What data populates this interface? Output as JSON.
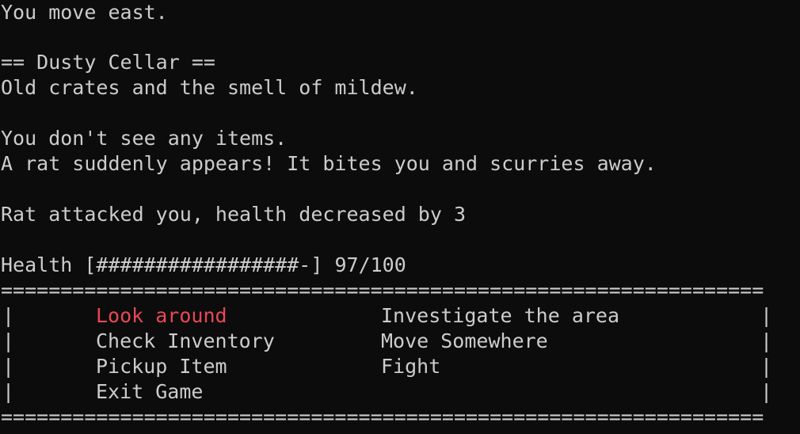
{
  "log": {
    "move": "You move east.",
    "room_title": "== Dusty Cellar ==",
    "room_desc": "Old crates and the smell of mildew.",
    "items": "You don't see any items.",
    "event": "A rat suddenly appears! It bites you and scurries away.",
    "attack": "Rat attacked you, health decreased by 3"
  },
  "health": {
    "label": "Health",
    "bar": "[#################-]",
    "value": "97/100",
    "current": 97,
    "max": 100
  },
  "menu": {
    "border": "================================================================",
    "pipe": "|",
    "options": [
      {
        "label": "Look around",
        "selected": true
      },
      {
        "label": "Investigate the area",
        "selected": false
      },
      {
        "label": "Check Inventory",
        "selected": false
      },
      {
        "label": "Move Somewhere",
        "selected": false
      },
      {
        "label": "Pickup Item",
        "selected": false
      },
      {
        "label": "Fight",
        "selected": false
      },
      {
        "label": "Exit Game",
        "selected": false
      }
    ]
  },
  "colors": {
    "background": "#0c0c0c",
    "text": "#cccccc",
    "selected": "#e74856"
  }
}
